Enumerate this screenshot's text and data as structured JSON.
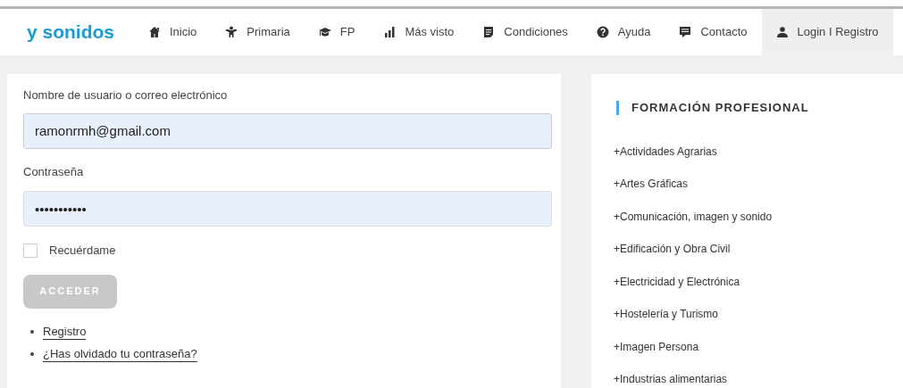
{
  "logo": "y sonidos",
  "nav": [
    {
      "kind": "home",
      "label": "Inicio",
      "selected": false
    },
    {
      "kind": "child",
      "label": "Primaria",
      "selected": false
    },
    {
      "kind": "cap",
      "label": "FP",
      "selected": false
    },
    {
      "kind": "bars",
      "label": "Más visto",
      "selected": false
    },
    {
      "kind": "doc",
      "label": "Condiciones",
      "selected": false
    },
    {
      "kind": "help",
      "label": "Ayuda",
      "selected": false
    },
    {
      "kind": "chat",
      "label": "Contacto",
      "selected": false
    },
    {
      "kind": "user",
      "label": "Login I Registro",
      "selected": true
    }
  ],
  "login": {
    "username_label": "Nombre de usuario o correo electrónico",
    "username_value": "ramonrmh@gmail.com",
    "password_label": "Contraseña",
    "password_value": "•••••••••••",
    "remember": {
      "label": "Recuérdame",
      "checked": false
    },
    "submit": {
      "label": "ACCEDER",
      "disabled": true
    },
    "links": [
      "Registro",
      "¿Has olvidado tu contraseña?"
    ]
  },
  "sidebar": {
    "title": "FORMACIÓN PROFESIONAL",
    "items": [
      "+Actividades Agrarias",
      "+Artes Gráficas",
      "+Comunicación, imagen y sonido",
      "+Edificación y Obra Civil",
      "+Electricidad y Electrónica",
      "+Hostelería y Turismo",
      "+Imagen Persona",
      "+Industrias alimentarias"
    ]
  }
}
